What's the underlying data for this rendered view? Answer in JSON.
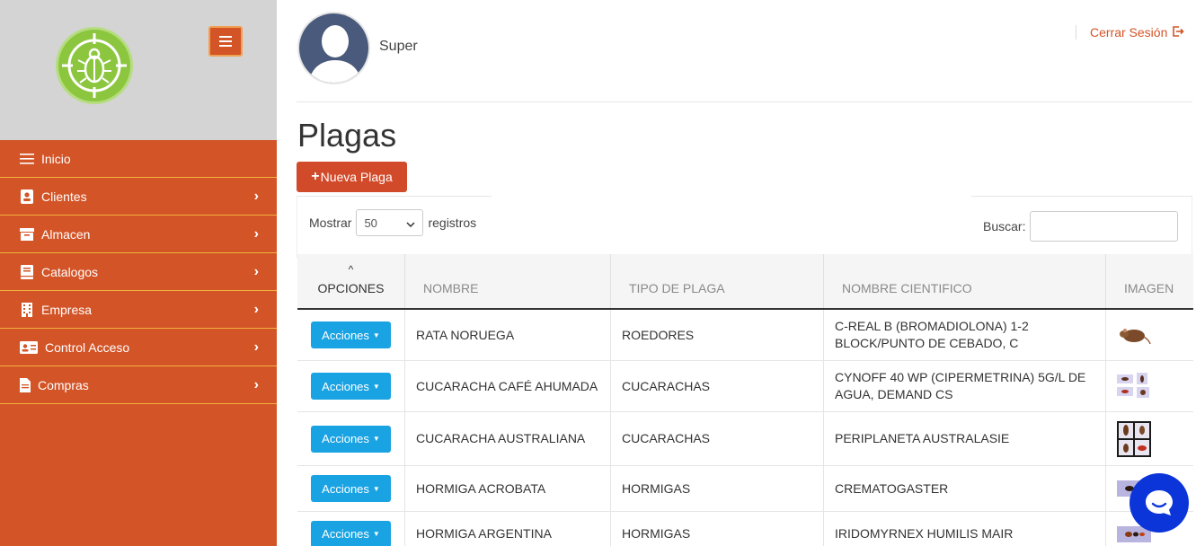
{
  "user": {
    "name": "Super"
  },
  "header": {
    "logout_label": "Cerrar Sesión"
  },
  "sidebar": {
    "items": [
      {
        "label": "Inicio",
        "icon": "list-icon",
        "has_children": false
      },
      {
        "label": "Clientes",
        "icon": "contact-card-icon",
        "has_children": true
      },
      {
        "label": "Almacen",
        "icon": "archive-box-icon",
        "has_children": true
      },
      {
        "label": "Catalogos",
        "icon": "book-icon",
        "has_children": true
      },
      {
        "label": "Empresa",
        "icon": "building-icon",
        "has_children": true
      },
      {
        "label": "Control Acceso",
        "icon": "id-card-icon",
        "has_children": true
      },
      {
        "label": "Compras",
        "icon": "document-icon",
        "has_children": true
      }
    ]
  },
  "page": {
    "title": "Plagas",
    "new_button_label": "Nueva Plaga",
    "show_label": "Mostrar",
    "show_value": "50",
    "records_label": "registros",
    "search_label": "Buscar:",
    "search_value": ""
  },
  "table": {
    "columns": [
      "OPCIONES",
      "NOMBRE",
      "TIPO DE PLAGA",
      "NOMBRE CIENTIFICO",
      "IMAGEN"
    ],
    "action_label": "Acciones",
    "rows": [
      {
        "nombre": "RATA NORUEGA",
        "tipo": "ROEDORES",
        "cientifico": "C-REAL B (BROMADIOLONA) 1-2 BLOCK/PUNTO DE CEBADO, C",
        "imagen": "rat-thumbnail"
      },
      {
        "nombre": "CUCARACHA CAFÉ AHUMADA",
        "tipo": "CUCARACHAS",
        "cientifico": "CYNOFF 40 WP (CIPERMETRINA) 5G/L DE AGUA, DEMAND CS",
        "imagen": "cockroach-thumbnail"
      },
      {
        "nombre": "CUCARACHA AUSTRALIANA",
        "tipo": "CUCARACHAS",
        "cientifico": "PERIPLANETA AUSTRALASIE",
        "imagen": "cockroach-grid-thumbnail"
      },
      {
        "nombre": "HORMIGA ACROBATA",
        "tipo": "HORMIGAS",
        "cientifico": "CREMATOGASTER",
        "imagen": "ant-thumbnail"
      },
      {
        "nombre": "HORMIGA ARGENTINA",
        "tipo": "HORMIGAS",
        "cientifico": "IRIDOMYRNEX HUMILIS MAIR",
        "imagen": "ant-thumbnail"
      }
    ]
  },
  "colors": {
    "sidebar": "#d35427",
    "accent_border": "#f0b13e",
    "action_button": "#1aa3e3",
    "chat": "#0b35d8"
  }
}
